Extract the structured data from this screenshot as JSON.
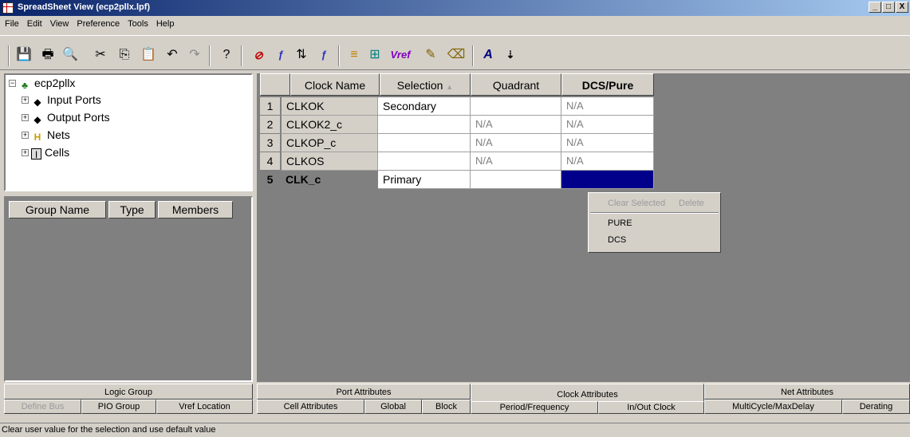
{
  "window": {
    "title": "SpreadSheet View (ecp2pllx.lpf)",
    "buttons": {
      "minimize": "_",
      "maximize": "□",
      "close": "X"
    }
  },
  "menu": [
    "File",
    "Edit",
    "View",
    "Preference",
    "Tools",
    "Help"
  ],
  "toolbar": {
    "icons": [
      "save-icon",
      "print-icon",
      "print-preview-icon",
      "cut-icon",
      "copy-icon",
      "paste-icon",
      "undo-icon",
      "redo-icon",
      "help-icon",
      "clear-icon",
      "assign-icon",
      "sort-icon",
      "filter-icon",
      "group-icon",
      "group2-icon",
      "vref-icon",
      "edit-icon",
      "erase-icon",
      "font-icon",
      "sort-az-icon"
    ],
    "vref_label": "Vref"
  },
  "tree": {
    "root": "ecp2pllx",
    "items": [
      "Input Ports",
      "Output Ports",
      "Nets",
      "Cells"
    ]
  },
  "group_panel": {
    "columns": [
      "Group Name",
      "Type",
      "Members"
    ]
  },
  "sheet": {
    "columns": [
      "Clock Name",
      "Selection",
      "Quadrant",
      "DCS/Pure"
    ],
    "sort_indicator": "▲",
    "rows": [
      {
        "num": "1",
        "clock": "CLKOK",
        "selection": "Secondary",
        "quadrant": "",
        "dcs": "N/A"
      },
      {
        "num": "2",
        "clock": "CLKOK2_c",
        "selection": "",
        "quadrant": "N/A",
        "dcs": "N/A"
      },
      {
        "num": "3",
        "clock": "CLKOP_c",
        "selection": "",
        "quadrant": "N/A",
        "dcs": "N/A"
      },
      {
        "num": "4",
        "clock": "CLKOS",
        "selection": "",
        "quadrant": "N/A",
        "dcs": "N/A"
      },
      {
        "num": "5",
        "clock": "CLK_c",
        "selection": "Primary",
        "quadrant": "",
        "dcs": ""
      }
    ]
  },
  "context_menu": {
    "clear_selected": "Clear Selected",
    "delete": "Delete",
    "items": [
      "PURE",
      "DCS"
    ]
  },
  "left_tabs": {
    "main": "Logic Group",
    "sub": [
      "Define Bus",
      "PIO Group",
      "Vref Location"
    ]
  },
  "right_tabs": {
    "main": [
      "Port Attributes",
      "Clock Attributes",
      "Net Attributes"
    ],
    "sub": [
      "Cell Attributes",
      "Global",
      "Block",
      "Period/Frequency",
      "In/Out Clock",
      "MultiCycle/MaxDelay",
      "Derating"
    ]
  },
  "status": "Clear user value for the selection and use default value",
  "colors": {
    "selected_cell": "#00008b",
    "titlebar_start": "#0a246a",
    "titlebar_end": "#a6caf0"
  }
}
